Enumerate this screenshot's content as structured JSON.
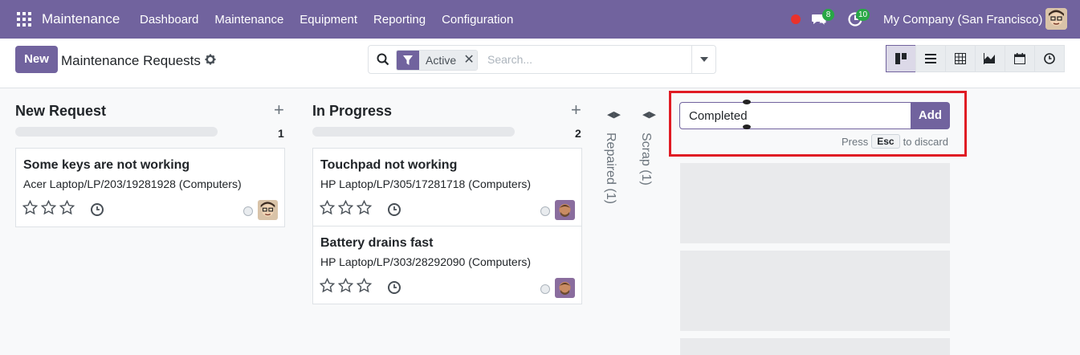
{
  "navbar": {
    "brand": "Maintenance",
    "menu": [
      "Dashboard",
      "Maintenance",
      "Equipment",
      "Reporting",
      "Configuration"
    ],
    "chat_badge": "8",
    "activity_badge": "10",
    "company": "My Company (San Francisco)"
  },
  "control_panel": {
    "new_label": "New",
    "title": "Maintenance Requests",
    "facet_value": "Active",
    "search_placeholder": "Search..."
  },
  "columns": [
    {
      "title": "New Request",
      "count": "1",
      "cards": [
        {
          "title": "Some keys are not working",
          "equipment": "Acer Laptop/LP/203/19281928 (Computers)"
        }
      ]
    },
    {
      "title": "In Progress",
      "count": "2",
      "cards": [
        {
          "title": "Touchpad not working",
          "equipment": "HP Laptop/LP/305/17281718 (Computers)"
        },
        {
          "title": "Battery drains fast",
          "equipment": "HP Laptop/LP/303/28292090 (Computers)"
        }
      ]
    }
  ],
  "folded_columns": [
    {
      "label": "Repaired (1)"
    },
    {
      "label": "Scrap (1)"
    }
  ],
  "quick_create": {
    "value": "Completed",
    "add_label": "Add",
    "hint_press": "Press",
    "hint_key": "Esc",
    "hint_after": "to discard"
  },
  "colors": {
    "brand": "#71639e",
    "highlight": "#e01b24",
    "badge": "#28a745"
  }
}
